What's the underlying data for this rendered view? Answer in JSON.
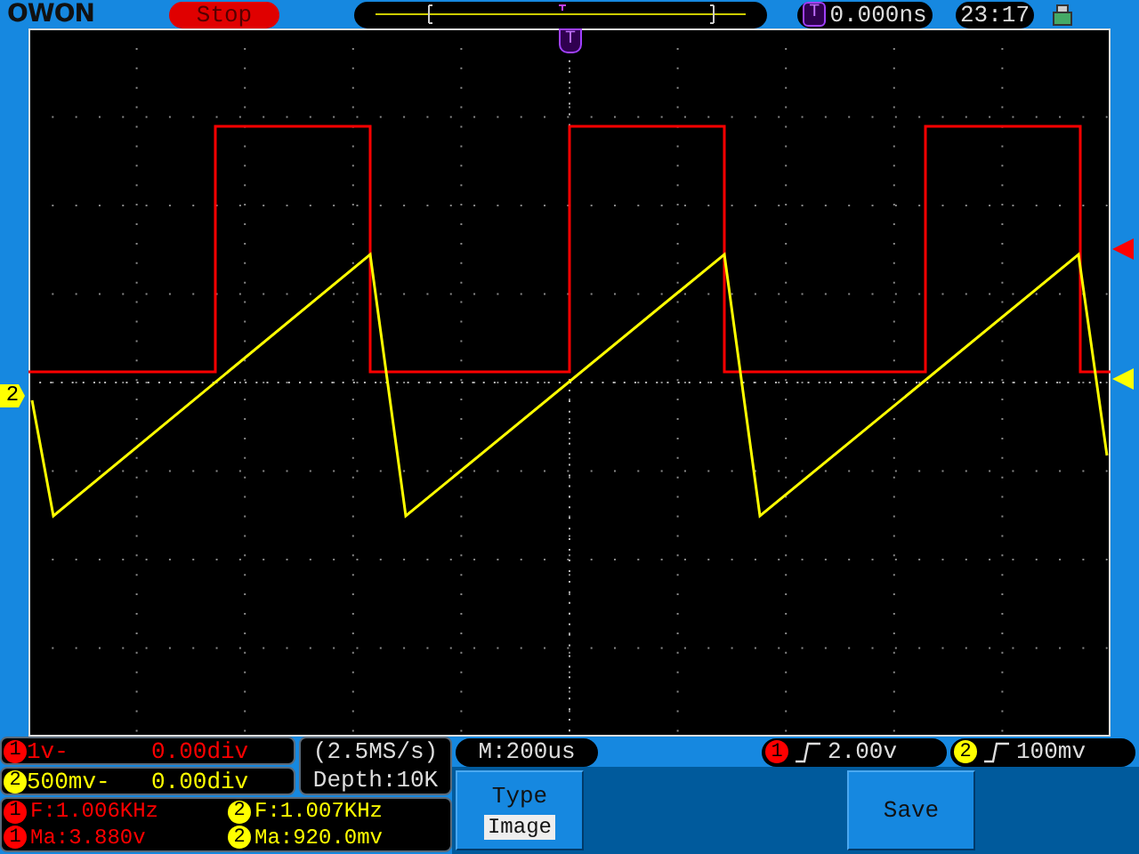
{
  "header": {
    "logo": "OWON",
    "run_state": "Stop",
    "trigger_badge": "T",
    "trigger_time": "0.000ns",
    "clock": "23:17"
  },
  "scope": {
    "trigger_marker": "T",
    "ground_marker": "2"
  },
  "channels": [
    {
      "color": "#ff0000",
      "scale": {
        "badge": "1",
        "text": "1v-",
        "offset": "0.00div"
      },
      "trigger": {
        "badge": "1",
        "level": "2.00v"
      },
      "frequency": {
        "badge": "1",
        "text": "F:1.006KHz"
      },
      "amplitude": {
        "badge": "1",
        "text": "Ma:3.880v"
      }
    },
    {
      "color": "#ffff00",
      "scale": {
        "badge": "2",
        "text": "500mv-",
        "offset": "0.00div"
      },
      "trigger": {
        "badge": "2",
        "level": "100mv"
      },
      "frequency": {
        "badge": "2",
        "text": "F:1.007KHz"
      },
      "amplitude": {
        "badge": "2",
        "text": "Ma:920.0mv"
      }
    }
  ],
  "acquisition": {
    "sample_rate": "(2.5MS/s)",
    "depth": "Depth:10K",
    "timebase": "M:200us"
  },
  "menu": [
    {
      "kind": "option",
      "label": "Type",
      "value": "Image"
    },
    {
      "kind": "action",
      "label": "Save"
    }
  ]
}
